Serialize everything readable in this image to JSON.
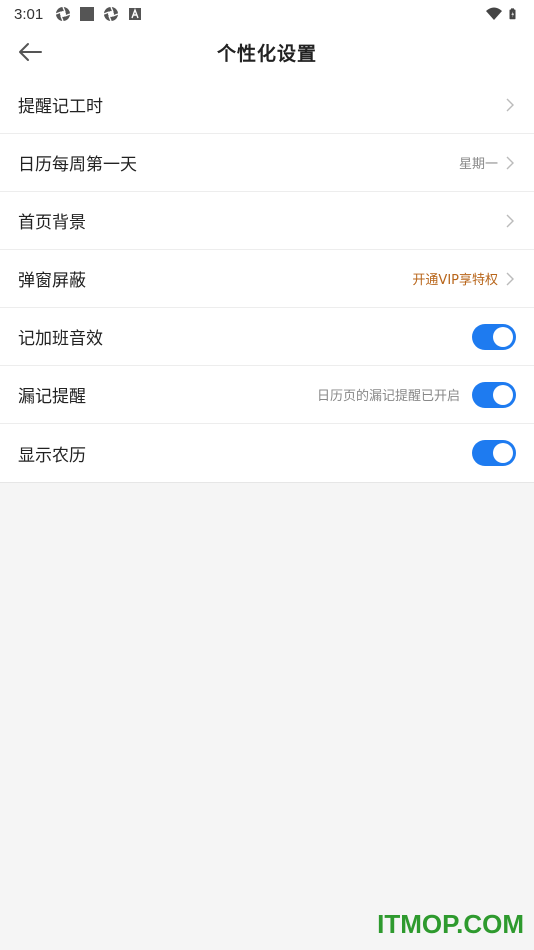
{
  "status_bar": {
    "time": "3:01",
    "left_icons": [
      "aperture-icon",
      "square-icon",
      "aperture-icon",
      "a-box-icon"
    ],
    "right_icons": [
      "wifi-icon",
      "battery-icon"
    ]
  },
  "header": {
    "title": "个性化设置",
    "back_icon": "arrow-left-icon"
  },
  "settings": [
    {
      "label": "提醒记工时",
      "value": "",
      "control": "chevron"
    },
    {
      "label": "日历每周第一天",
      "value": "星期一",
      "control": "chevron"
    },
    {
      "label": "首页背景",
      "value": "",
      "control": "chevron"
    },
    {
      "label": "弹窗屏蔽",
      "value": "开通VIP享特权",
      "control": "chevron",
      "value_color": "#b8651a"
    },
    {
      "label": "记加班音效",
      "hint": "",
      "control": "toggle",
      "on": true
    },
    {
      "label": "漏记提醒",
      "hint": "日历页的漏记提醒已开启",
      "control": "toggle",
      "on": true
    },
    {
      "label": "显示农历",
      "hint": "",
      "control": "toggle",
      "on": true
    }
  ],
  "colors": {
    "toggle_on": "#1e7bf0",
    "vip_text": "#b8651a",
    "watermark": "#2e9a2e"
  },
  "watermark": "ITMOP.COM"
}
